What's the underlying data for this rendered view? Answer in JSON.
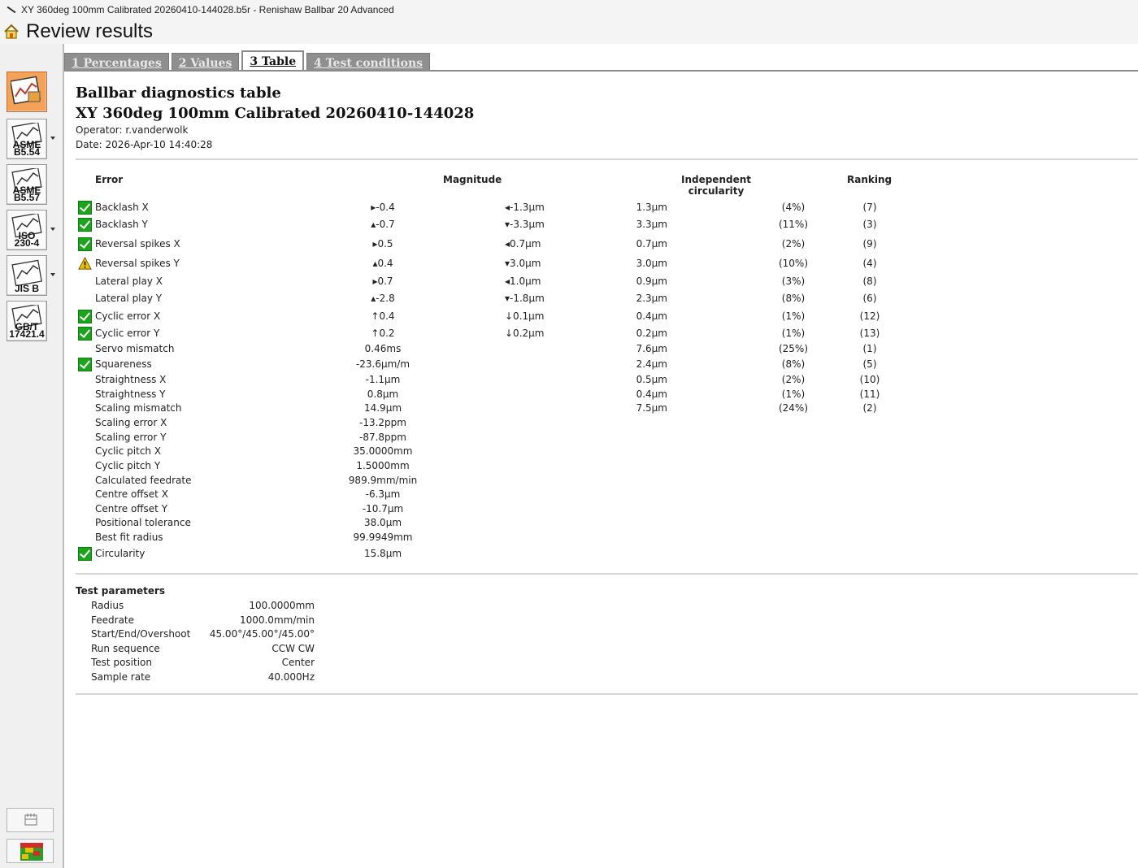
{
  "window": {
    "title": "XY 360deg 100mm Calibrated 20260410-144028.b5r - Renishaw Ballbar 20 Advanced"
  },
  "header": {
    "title": "Review results"
  },
  "toolbar": {
    "tools": [
      {
        "name": "ballbar-analysis",
        "label": "",
        "active": true
      },
      {
        "name": "asme-b554",
        "label_top": "ASME",
        "label": "B5.54",
        "active": false,
        "dropdown": true
      },
      {
        "name": "asme-b557",
        "label_top": "ASME",
        "label": "B5.57",
        "active": false,
        "dropdown": false
      },
      {
        "name": "iso-2304",
        "label_top": "ISO",
        "label": "230-4",
        "active": false,
        "dropdown": true
      },
      {
        "name": "jis-b",
        "label_top": "",
        "label": "JIS B",
        "active": false,
        "dropdown": true
      },
      {
        "name": "gbt-174214",
        "label_top": "GB/T",
        "label": "17421.4",
        "active": false,
        "dropdown": false
      }
    ]
  },
  "tabs": [
    {
      "label": "1 Percentages",
      "active": false
    },
    {
      "label": "2 Values",
      "active": false
    },
    {
      "label": "3 Table",
      "active": true
    },
    {
      "label": "4 Test conditions",
      "active": false
    }
  ],
  "report": {
    "title": "Ballbar diagnostics table",
    "subtitle": "XY 360deg 100mm Calibrated 20260410-144028",
    "operator": "Operator: r.vanderwolk",
    "date": "Date: 2026-Apr-10 14:40:28"
  },
  "table": {
    "headers": {
      "error": "Error",
      "magnitude": "Magnitude",
      "independent_line1": "Independent",
      "independent_line2": "circularity",
      "ranking": "Ranking"
    },
    "rows": [
      {
        "status": "ok",
        "name": "Backlash X",
        "mag": "▸-0.4",
        "mag2": "◂-1.3µm",
        "circ": "1.3µm",
        "pct": "(4%)",
        "rank": "(7)"
      },
      {
        "status": "ok",
        "name": "Backlash Y",
        "mag": "▴-0.7",
        "mag2": "▾-3.3µm",
        "circ": "3.3µm",
        "pct": "(11%)",
        "rank": "(3)"
      },
      {
        "status": "ok",
        "name": "Reversal spikes X",
        "mag": "▸0.5",
        "mag2": "◂0.7µm",
        "circ": "0.7µm",
        "pct": "(2%)",
        "rank": "(9)"
      },
      {
        "status": "warn",
        "name": "Reversal spikes Y",
        "mag": "▴0.4",
        "mag2": "▾3.0µm",
        "circ": "3.0µm",
        "pct": "(10%)",
        "rank": "(4)"
      },
      {
        "status": "none",
        "name": "Lateral play X",
        "mag": "▸0.7",
        "mag2": "◂1.0µm",
        "circ": "0.9µm",
        "pct": "(3%)",
        "rank": "(8)"
      },
      {
        "status": "none",
        "name": "Lateral play Y",
        "mag": "▴-2.8",
        "mag2": "▾-1.8µm",
        "circ": "2.3µm",
        "pct": "(8%)",
        "rank": "(6)"
      },
      {
        "status": "ok",
        "name": "Cyclic error X",
        "mag": "↑0.4",
        "mag2": "↓0.1µm",
        "circ": "0.4µm",
        "pct": "(1%)",
        "rank": "(12)"
      },
      {
        "status": "ok",
        "name": "Cyclic error Y",
        "mag": "↑0.2",
        "mag2": "↓0.2µm",
        "circ": "0.2µm",
        "pct": "(1%)",
        "rank": "(13)"
      },
      {
        "status": "none",
        "name": "Servo mismatch",
        "mag": "0.46ms",
        "mag2": "",
        "circ": "7.6µm",
        "pct": "(25%)",
        "rank": "(1)"
      },
      {
        "status": "ok",
        "name": "Squareness",
        "mag": "-23.6µm/m",
        "mag2": "",
        "circ": "2.4µm",
        "pct": "(8%)",
        "rank": "(5)"
      },
      {
        "status": "none",
        "name": "Straightness X",
        "mag": "-1.1µm",
        "mag2": "",
        "circ": "0.5µm",
        "pct": "(2%)",
        "rank": "(10)"
      },
      {
        "status": "none",
        "name": "Straightness Y",
        "mag": "0.8µm",
        "mag2": "",
        "circ": "0.4µm",
        "pct": "(1%)",
        "rank": "(11)"
      },
      {
        "status": "none",
        "name": "Scaling mismatch",
        "mag": "14.9µm",
        "mag2": "",
        "circ": "7.5µm",
        "pct": "(24%)",
        "rank": "(2)"
      },
      {
        "status": "none",
        "name": "Scaling error X",
        "mag": "-13.2ppm",
        "mag2": "",
        "circ": "",
        "pct": "",
        "rank": ""
      },
      {
        "status": "none",
        "name": "Scaling error Y",
        "mag": "-87.8ppm",
        "mag2": "",
        "circ": "",
        "pct": "",
        "rank": ""
      },
      {
        "status": "none",
        "name": "Cyclic pitch X",
        "mag": "35.0000mm",
        "mag2": "",
        "circ": "",
        "pct": "",
        "rank": ""
      },
      {
        "status": "none",
        "name": "Cyclic pitch Y",
        "mag": "1.5000mm",
        "mag2": "",
        "circ": "",
        "pct": "",
        "rank": ""
      },
      {
        "status": "none",
        "name": "Calculated feedrate",
        "mag": "989.9mm/min",
        "mag2": "",
        "circ": "",
        "pct": "",
        "rank": ""
      },
      {
        "status": "none",
        "name": "Centre offset X",
        "mag": "-6.3µm",
        "mag2": "",
        "circ": "",
        "pct": "",
        "rank": ""
      },
      {
        "status": "none",
        "name": "Centre offset Y",
        "mag": "-10.7µm",
        "mag2": "",
        "circ": "",
        "pct": "",
        "rank": ""
      },
      {
        "status": "none",
        "name": "Positional tolerance",
        "mag": "38.0µm",
        "mag2": "",
        "circ": "",
        "pct": "",
        "rank": ""
      },
      {
        "status": "none",
        "name": "Best fit radius",
        "mag": "99.9949mm",
        "mag2": "",
        "circ": "",
        "pct": "",
        "rank": ""
      },
      {
        "status": "ok",
        "name": "Circularity",
        "mag": "15.8µm",
        "mag2": "",
        "circ": "",
        "pct": "",
        "rank": ""
      }
    ]
  },
  "parameters": {
    "title": "Test parameters",
    "items": [
      {
        "label": "Radius",
        "value": "100.0000mm"
      },
      {
        "label": "Feedrate",
        "value": "1000.0mm/min"
      },
      {
        "label": "Start/End/Overshoot",
        "value": "45.00°/45.00°/45.00°"
      },
      {
        "label": "Run sequence",
        "value": "CCW CW"
      },
      {
        "label": "Test position",
        "value": "Center"
      },
      {
        "label": "Sample rate",
        "value": "40.000Hz"
      }
    ]
  },
  "colors": {
    "ok": "#1aa51a",
    "warn": "#f2c200",
    "tab_inactive": "#8f8f8f",
    "active_tool": "#f4a25a"
  }
}
